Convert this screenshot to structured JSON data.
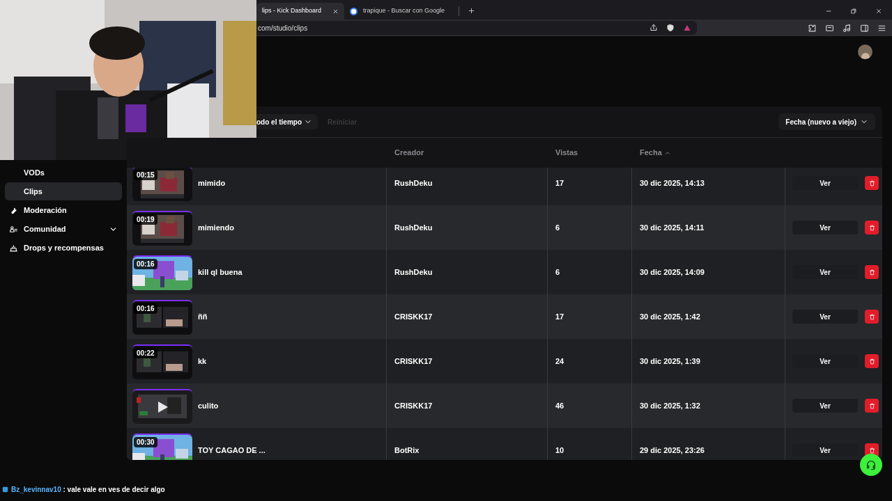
{
  "browser": {
    "tabs": [
      {
        "label": "lips - Kick Dashboard",
        "selected": true
      },
      {
        "label": "trapique - Buscar con Google",
        "selected": false
      }
    ],
    "address": "com/studio/clips"
  },
  "sidebar": {
    "items": [
      {
        "label": "VODs",
        "selected": false,
        "expandable": false
      },
      {
        "label": "Clips",
        "selected": true,
        "expandable": false
      },
      {
        "label": "Moderación",
        "selected": false,
        "expandable": false
      },
      {
        "label": "Comunidad",
        "selected": false,
        "expandable": true
      },
      {
        "label": "Drops y recompensas",
        "selected": false,
        "expandable": false
      }
    ]
  },
  "filters": {
    "period": "odo el tiempo",
    "reset": "Reiniciar",
    "sort": "Fecha (nuevo a viejo)"
  },
  "table": {
    "columns": [
      {
        "label": "Creador",
        "sorted": false
      },
      {
        "label": "Vistas",
        "sorted": false
      },
      {
        "label": "Fecha",
        "sorted": true
      }
    ],
    "rows": [
      {
        "duration": "00:15",
        "title": "mimido",
        "creator": "RushDeku",
        "views": "17",
        "date": "30 dic 2025, 14:13",
        "action": "Ver"
      },
      {
        "duration": "00:19",
        "title": "mimiendo",
        "creator": "RushDeku",
        "views": "6",
        "date": "30 dic 2025, 14:11",
        "action": "Ver"
      },
      {
        "duration": "00:16",
        "title": "kill ql buena",
        "creator": "RushDeku",
        "views": "6",
        "date": "30 dic 2025, 14:09",
        "action": "Ver"
      },
      {
        "duration": "00:16",
        "title": "ññ",
        "creator": "CRISKK17",
        "views": "17",
        "date": "30 dic 2025, 1:42",
        "action": "Ver"
      },
      {
        "duration": "00:22",
        "title": "kk",
        "creator": "CRISKK17",
        "views": "24",
        "date": "30 dic 2025, 1:39",
        "action": "Ver"
      },
      {
        "title": "culito",
        "creator": "CRISKK17",
        "views": "46",
        "date": "30 dic 2025, 1:32",
        "action": "Ver"
      },
      {
        "duration": "00:30",
        "title": "TOY CAGAO DE ...",
        "creator": "BotRix",
        "views": "10",
        "date": "29 dic 2025, 23:26",
        "action": "Ver"
      }
    ]
  },
  "chat": {
    "user": "Bz_kevinnav10",
    "message": ": vale vale en ves de decir algo"
  }
}
